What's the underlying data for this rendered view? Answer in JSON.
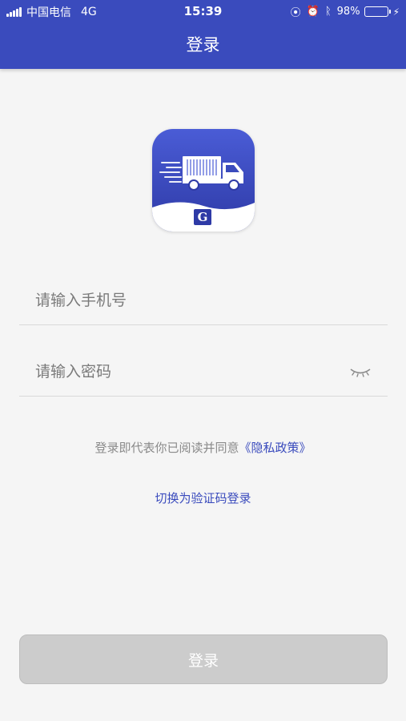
{
  "status_bar": {
    "carrier": "中国电信",
    "network": "4G",
    "time": "15:39",
    "battery_text": "98%",
    "battery_level": 0.98,
    "icons": [
      "signal-icon",
      "orientation-lock-icon",
      "alarm-icon",
      "bluetooth-icon",
      "battery-icon",
      "charging-icon"
    ]
  },
  "header": {
    "title": "登录"
  },
  "logo": {
    "letter": "G",
    "icon": "truck-icon",
    "color": "#3a4bbd"
  },
  "form": {
    "phone_placeholder": "请输入手机号",
    "password_placeholder": "请输入密码",
    "password_toggle_icon": "eye-closed-icon"
  },
  "agreement": {
    "text": "登录即代表你已阅读并同意",
    "link": "《隐私政策》"
  },
  "switch_login": "切换为验证码登录",
  "login_button": "登录",
  "colors": {
    "primary": "#3a4bbd",
    "background": "#f5f5f5",
    "button_disabled": "#cccccc"
  }
}
